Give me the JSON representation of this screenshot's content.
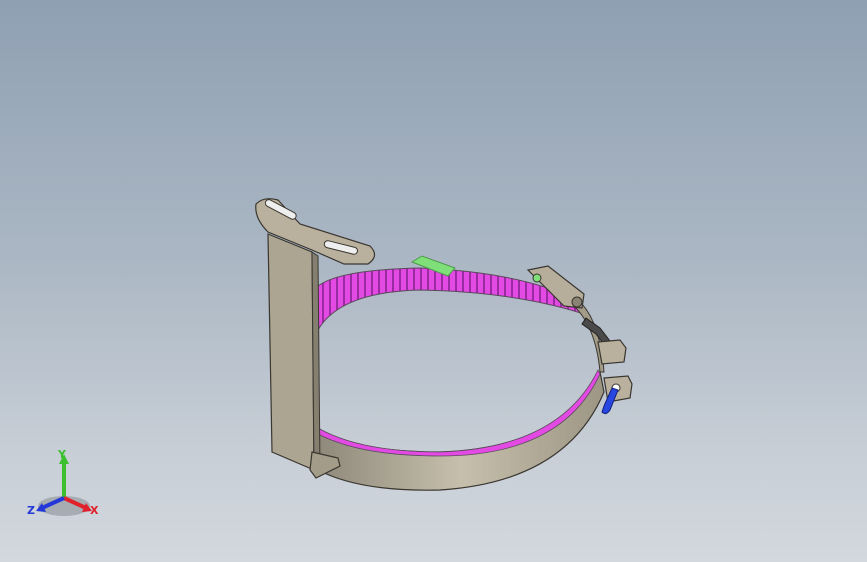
{
  "axes": {
    "x_label": "X",
    "y_label": "Y",
    "z_label": "Z",
    "x_color": "#e0212b",
    "y_color": "#3bbf2e",
    "z_color": "#2438d8"
  },
  "model": {
    "band_color": "#b3ab98",
    "inner_color": "#e34ae4",
    "bracket_color": "#a9a291",
    "bolt_color": "#2846e0",
    "handle_color": "#7fe07a"
  }
}
